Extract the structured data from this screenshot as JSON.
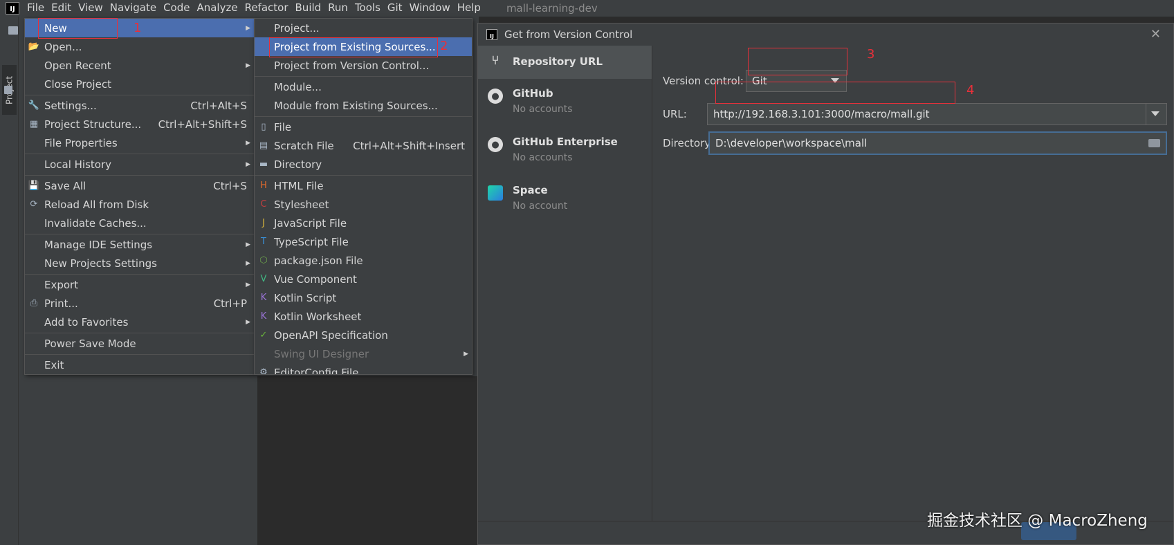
{
  "menubar": {
    "logo": "IJ",
    "items": [
      "File",
      "Edit",
      "View",
      "Navigate",
      "Code",
      "Analyze",
      "Refactor",
      "Build",
      "Run",
      "Tools",
      "Git",
      "Window",
      "Help"
    ],
    "project_name": "mall-learning-dev"
  },
  "toolstrip": {
    "project_tab": "Project"
  },
  "file_menu": {
    "items": [
      {
        "label": "New",
        "arrow": true,
        "selected": true
      },
      {
        "label": "Open...",
        "icon": "folder-open-icon"
      },
      {
        "label": "Open Recent",
        "arrow": true
      },
      {
        "label": "Close Project"
      },
      {
        "sep": true
      },
      {
        "label": "Settings...",
        "shortcut": "Ctrl+Alt+S",
        "icon": "wrench-icon"
      },
      {
        "label": "Project Structure...",
        "shortcut": "Ctrl+Alt+Shift+S",
        "icon": "project-structure-icon"
      },
      {
        "label": "File Properties",
        "arrow": true
      },
      {
        "sep": true
      },
      {
        "label": "Local History",
        "arrow": true
      },
      {
        "sep": true
      },
      {
        "label": "Save All",
        "shortcut": "Ctrl+S",
        "icon": "save-icon"
      },
      {
        "label": "Reload All from Disk",
        "icon": "reload-icon"
      },
      {
        "label": "Invalidate Caches..."
      },
      {
        "sep": true
      },
      {
        "label": "Manage IDE Settings",
        "arrow": true
      },
      {
        "label": "New Projects Settings",
        "arrow": true
      },
      {
        "sep": true
      },
      {
        "label": "Export",
        "arrow": true
      },
      {
        "label": "Print...",
        "shortcut": "Ctrl+P",
        "icon": "print-icon"
      },
      {
        "label": "Add to Favorites",
        "arrow": true
      },
      {
        "sep": true
      },
      {
        "label": "Power Save Mode"
      },
      {
        "sep": true
      },
      {
        "label": "Exit"
      }
    ]
  },
  "new_menu": {
    "items": [
      {
        "label": "Project..."
      },
      {
        "label": "Project from Existing Sources...",
        "selected": true
      },
      {
        "label": "Project from Version Control..."
      },
      {
        "sep": true
      },
      {
        "label": "Module..."
      },
      {
        "label": "Module from Existing Sources..."
      },
      {
        "sep": true
      },
      {
        "label": "File",
        "icon": "file-icon"
      },
      {
        "label": "Scratch File",
        "shortcut": "Ctrl+Alt+Shift+Insert",
        "icon": "scratch-file-icon"
      },
      {
        "label": "Directory",
        "icon": "directory-icon"
      },
      {
        "sep": true
      },
      {
        "label": "HTML File",
        "icon": "html-file-icon"
      },
      {
        "label": "Stylesheet",
        "icon": "css-file-icon"
      },
      {
        "label": "JavaScript File",
        "icon": "js-file-icon"
      },
      {
        "label": "TypeScript File",
        "icon": "ts-file-icon"
      },
      {
        "label": "package.json File",
        "icon": "package-json-icon"
      },
      {
        "label": "Vue Component",
        "icon": "vue-icon"
      },
      {
        "label": "Kotlin Script",
        "icon": "kotlin-script-icon"
      },
      {
        "label": "Kotlin Worksheet",
        "icon": "kotlin-worksheet-icon"
      },
      {
        "label": "OpenAPI Specification",
        "icon": "openapi-icon"
      },
      {
        "label": "Swing UI Designer",
        "arrow": true,
        "disabled": true
      },
      {
        "label": "EditorConfig File",
        "icon": "gear-icon"
      }
    ]
  },
  "annotations": [
    "1",
    "2",
    "3",
    "4"
  ],
  "dialog": {
    "title": "Get from Version Control",
    "sidebar": [
      {
        "title": "Repository URL",
        "sub": ""
      },
      {
        "title": "GitHub",
        "sub": "No accounts"
      },
      {
        "title": "GitHub Enterprise",
        "sub": "No accounts"
      },
      {
        "title": "Space",
        "sub": "No account"
      }
    ],
    "version_control_label": "Version control:",
    "version_control_value": "Git",
    "url_label": "URL:",
    "url_value": "http://192.168.3.101:3000/macro/mall.git",
    "directory_label": "Directory:",
    "directory_value": "D:\\developer\\workspace\\mall"
  },
  "watermark": "掘金技术社区 @ MacroZheng",
  "colors": {
    "selection": "#4b6eaf",
    "annotation": "#e8303a",
    "background": "#3c3f41"
  }
}
